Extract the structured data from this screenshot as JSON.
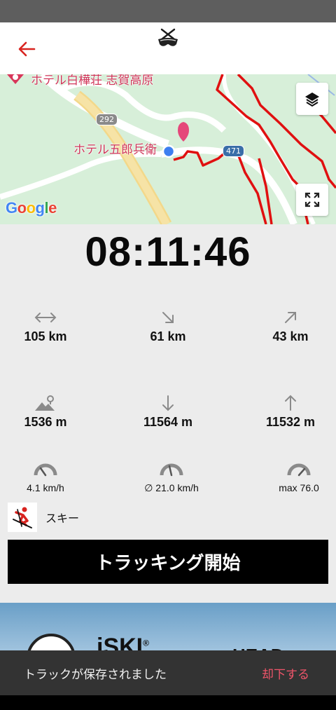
{
  "map": {
    "label_top": "ホテル白樺荘 志賀高原",
    "label_hotel": "ホテル五郎兵衛",
    "road_292": "292",
    "road_471": "471",
    "google": [
      "G",
      "o",
      "o",
      "g",
      "l",
      "e"
    ],
    "google_colors": [
      "#4285F4",
      "#EA4335",
      "#FBBC05",
      "#4285F4",
      "#34A853",
      "#EA4335"
    ]
  },
  "timer": "08:11:46",
  "stats": {
    "distance": "105 km",
    "descent_distance": "61 km",
    "ascent_distance": "43 km",
    "altitude": "1536 m",
    "total_descent": "11564 m",
    "total_ascent": "11532 m",
    "speed": "4.1 km/h",
    "avg_speed": "∅ 21.0 km/h",
    "max_speed": "max 76.0"
  },
  "activity": {
    "label": "スキー"
  },
  "start_button": "トラッキング開始",
  "banner": {
    "brand": "iSKI",
    "brand_mark": "®",
    "partner": "HEAD"
  },
  "snackbar": {
    "message": "トラックが保存されました",
    "action": "却下する"
  },
  "colors": {
    "accent": "#d8231f",
    "track": "#e01010",
    "snack_action": "#f0556a"
  }
}
